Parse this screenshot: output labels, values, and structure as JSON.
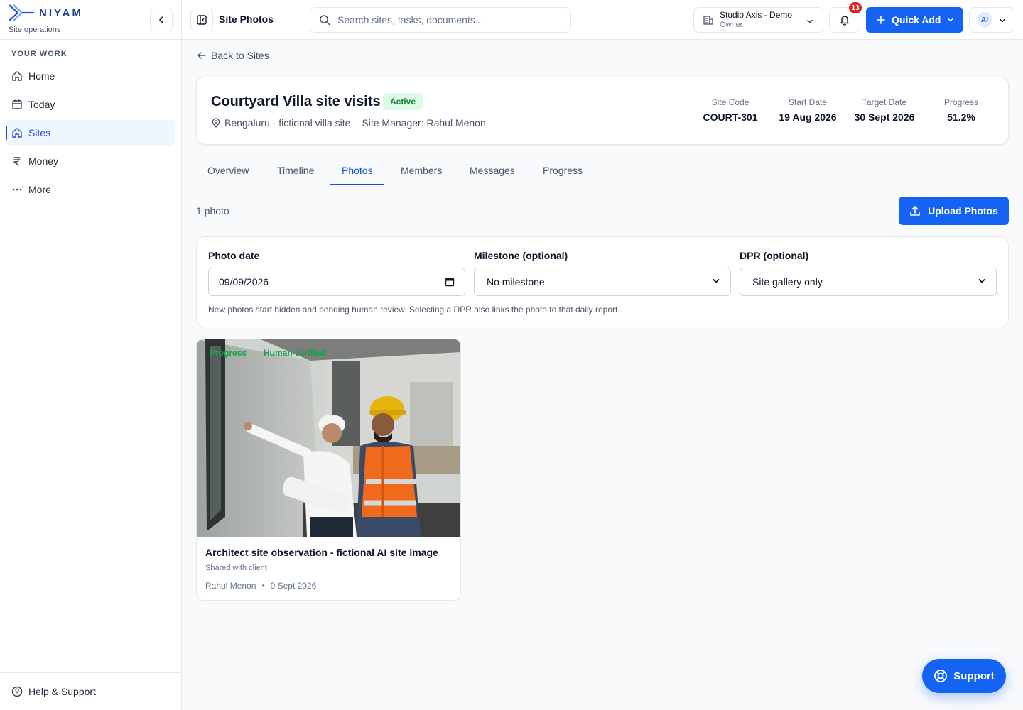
{
  "brand": {
    "name": "NIYAM",
    "subtitle": "Site operations"
  },
  "sidebar": {
    "heading": "YOUR WORK",
    "items": [
      {
        "label": "Home",
        "icon": "home-icon",
        "active": false
      },
      {
        "label": "Today",
        "icon": "calendar-icon",
        "active": false
      },
      {
        "label": "Sites",
        "icon": "home-icon",
        "active": true
      },
      {
        "label": "Money",
        "icon": "rupee-icon",
        "active": false
      },
      {
        "label": "More",
        "icon": "more-dots-icon",
        "active": false
      }
    ],
    "footer_label": "Help & Support"
  },
  "header": {
    "title": "Site Photos",
    "search_placeholder": "Search sites, tasks, documents...",
    "org_name": "Studio Axis - Demo",
    "org_role": "Owner",
    "notification_count": "13",
    "quick_add_label": "Quick Add",
    "avatar_initials": "AI"
  },
  "back_label": "Back to Sites",
  "site": {
    "title": "Courtyard Villa site visits",
    "status": "Active",
    "location": "Bengaluru - fictional villa site",
    "manager": "Site Manager: Rahul Menon",
    "stats": [
      {
        "label": "Site Code",
        "value": "COURT-301"
      },
      {
        "label": "Start Date",
        "value": "19 Aug 2026"
      },
      {
        "label": "Target Date",
        "value": "30 Sept 2026"
      },
      {
        "label": "Progress",
        "value": "51.2%"
      }
    ]
  },
  "tabs": [
    {
      "label": "Overview"
    },
    {
      "label": "Timeline"
    },
    {
      "label": "Photos",
      "active": true
    },
    {
      "label": "Members"
    },
    {
      "label": "Messages"
    },
    {
      "label": "Progress"
    }
  ],
  "photos": {
    "count_label": "1 photo",
    "upload_label": "Upload Photos"
  },
  "form": {
    "date_label": "Photo date",
    "date_value": "09/09/2026",
    "milestone_label": "Milestone (optional)",
    "milestone_value": "No milestone",
    "dpr_label": "DPR (optional)",
    "dpr_value": "Site gallery only",
    "note": "New photos start hidden and pending human review. Selecting a DPR also links the photo to that daily report."
  },
  "photo_card": {
    "tags": [
      "Progress",
      "Human verified"
    ],
    "title": "Architect site observation - fictional AI site image",
    "share_status": "Shared with client",
    "author": "Rahul Menon",
    "date": "9 Sept 2026"
  },
  "support_label": "Support",
  "colors": {
    "primary": "#1463f3",
    "active_nav": "#1d4ed8",
    "success": "#15803d",
    "badge": "#dc2626"
  }
}
